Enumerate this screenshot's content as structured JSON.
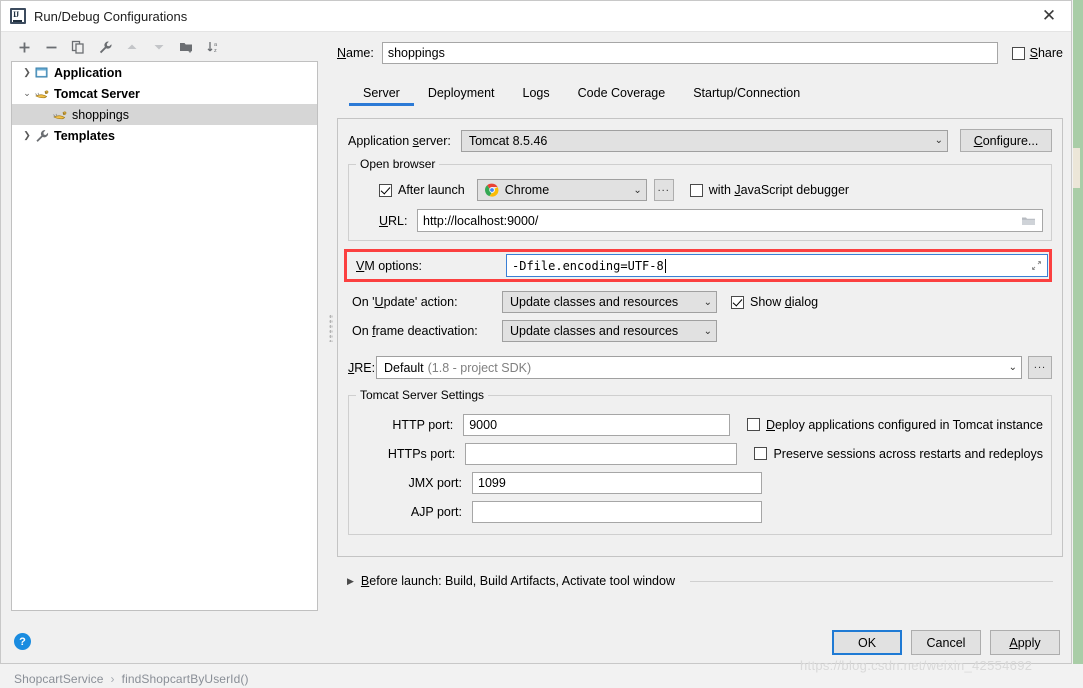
{
  "window": {
    "title": "Run/Debug Configurations",
    "close_label": "✕",
    "app_icon": "intellij-idea-icon"
  },
  "toolbar": {
    "buttons": [
      {
        "name": "add-configuration-button",
        "icon": "plus-icon",
        "tooltip": "Add New Configuration"
      },
      {
        "name": "remove-configuration-button",
        "icon": "minus-icon",
        "tooltip": "Remove Configuration"
      },
      {
        "name": "copy-configuration-button",
        "icon": "copy-icon",
        "tooltip": "Copy Configuration"
      },
      {
        "name": "edit-defaults-button",
        "icon": "wrench-icon",
        "tooltip": "Edit defaults"
      },
      {
        "name": "move-up-button",
        "icon": "arrow-up-icon",
        "tooltip": "Move Up"
      },
      {
        "name": "move-down-button",
        "icon": "arrow-down-icon",
        "tooltip": "Move Down"
      },
      {
        "name": "create-folder-button",
        "icon": "new-folder-icon",
        "tooltip": "Create New Folder"
      },
      {
        "name": "sort-button",
        "icon": "sort-alpha-icon",
        "tooltip": "Sort Configurations"
      }
    ]
  },
  "tree": {
    "items": [
      {
        "label": "Application",
        "icon": "application-icon",
        "expander": "collapsed",
        "level": 0,
        "selected": false
      },
      {
        "label": "Tomcat Server",
        "icon": "tomcat-icon",
        "expander": "expanded",
        "level": 0,
        "selected": false
      },
      {
        "label": "shoppings",
        "icon": "tomcat-icon",
        "expander": "none",
        "level": 1,
        "selected": true
      },
      {
        "label": "Templates",
        "icon": "wrench-icon",
        "expander": "collapsed",
        "level": 0,
        "selected": false
      }
    ]
  },
  "form": {
    "name_label": "Name:",
    "name_value": "shoppings",
    "share_label": "Share",
    "share_checked": false
  },
  "tabs": {
    "items": [
      {
        "label": "Server",
        "active": true
      },
      {
        "label": "Deployment",
        "active": false
      },
      {
        "label": "Logs",
        "active": false
      },
      {
        "label": "Code Coverage",
        "active": false
      },
      {
        "label": "Startup/Connection",
        "active": false
      }
    ]
  },
  "server_tab": {
    "application_server_label": "Application server:",
    "application_server_value": "Tomcat 8.5.46",
    "configure_button": "Configure...",
    "open_browser": {
      "legend": "Open browser",
      "after_launch_label": "After launch",
      "after_launch_checked": true,
      "browser_value": "Chrome",
      "browser_icon": "chrome-icon",
      "browse_button": "...",
      "js_debugger_label": "with JavaScript debugger",
      "js_debugger_checked": false,
      "url_label": "URL:",
      "url_value": "http://localhost:9000/",
      "url_folder_icon": "folder-icon"
    },
    "vm_options": {
      "label": "VM options:",
      "value": "-Dfile.encoding=UTF-8",
      "expand_icon": "expand-icon",
      "highlight_color": "#fb4040",
      "focus_color": "#3a7fd5"
    },
    "on_update_label": "On 'Update' action:",
    "on_update_value": "Update classes and resources",
    "show_dialog_label": "Show dialog",
    "show_dialog_checked": true,
    "on_frame_deactivation_label": "On frame deactivation:",
    "on_frame_deactivation_value": "Update classes and resources",
    "jre_label": "JRE:",
    "jre_value": "Default",
    "jre_value_muted": "(1.8 - project SDK)",
    "jre_browse_button": "...",
    "tomcat_settings": {
      "legend": "Tomcat Server Settings",
      "ports": [
        {
          "label": "HTTP port:",
          "value": "9000",
          "name": "http-port-input"
        },
        {
          "label": "HTTPs port:",
          "value": "",
          "name": "https-port-input"
        },
        {
          "label": "JMX port:",
          "value": "1099",
          "name": "jmx-port-input"
        },
        {
          "label": "AJP port:",
          "value": "",
          "name": "ajp-port-input"
        }
      ],
      "checkboxes": [
        {
          "label": "Deploy applications configured in Tomcat instance",
          "checked": false,
          "name": "deploy-applications-checkbox"
        },
        {
          "label": "Preserve sessions across restarts and redeploys",
          "checked": false,
          "name": "preserve-sessions-checkbox"
        }
      ]
    },
    "before_launch": "Before launch: Build, Build Artifacts, Activate tool window"
  },
  "footer": {
    "help_label": "?",
    "ok_label": "OK",
    "cancel_label": "Cancel",
    "apply_label": "Apply"
  },
  "background": {
    "breadcrumb_class": "ShopcartService",
    "breadcrumb_sep": "›",
    "breadcrumb_method": "findShopcartByUserId()",
    "watermark": "https://blog.csdn.net/weixin_42554692"
  }
}
